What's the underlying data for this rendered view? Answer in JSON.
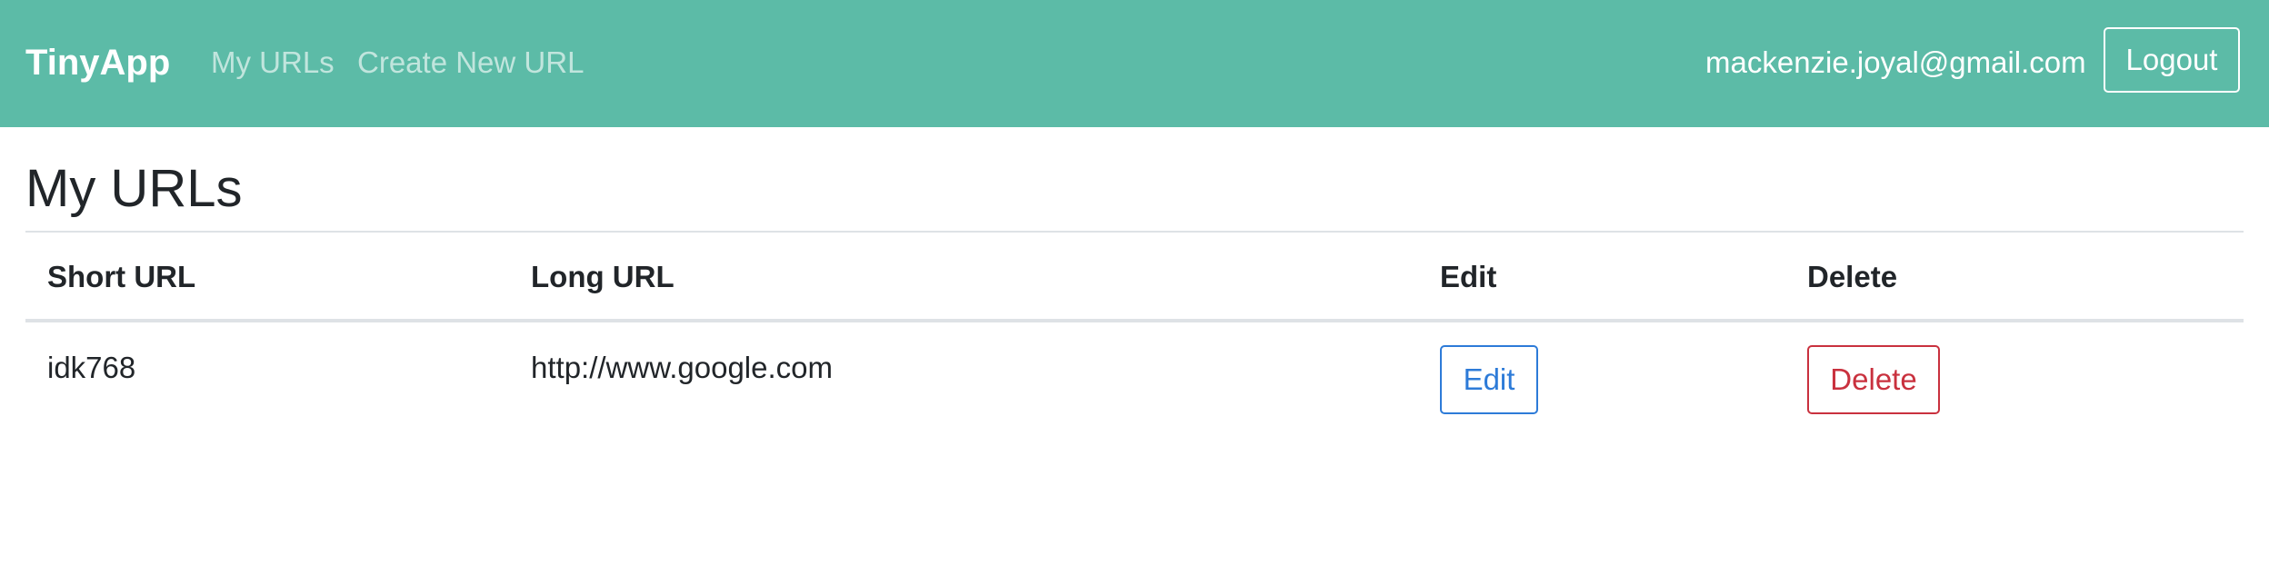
{
  "navbar": {
    "brand": "TinyApp",
    "links": [
      {
        "label": "My URLs"
      },
      {
        "label": "Create New URL"
      }
    ],
    "user_email": "mackenzie.joyal@gmail.com",
    "logout_label": "Logout"
  },
  "main": {
    "title": "My URLs",
    "table": {
      "headers": [
        "Short URL",
        "Long URL",
        "Edit",
        "Delete"
      ],
      "rows": [
        {
          "short_url": "idk768",
          "long_url": "http://www.google.com",
          "edit_label": "Edit",
          "delete_label": "Delete"
        }
      ]
    }
  },
  "colors": {
    "navbar_bg": "#5cbba7",
    "edit_accent": "#2d7bd8",
    "delete_accent": "#c9313e",
    "text": "#212529",
    "divider": "#dee2e6"
  }
}
